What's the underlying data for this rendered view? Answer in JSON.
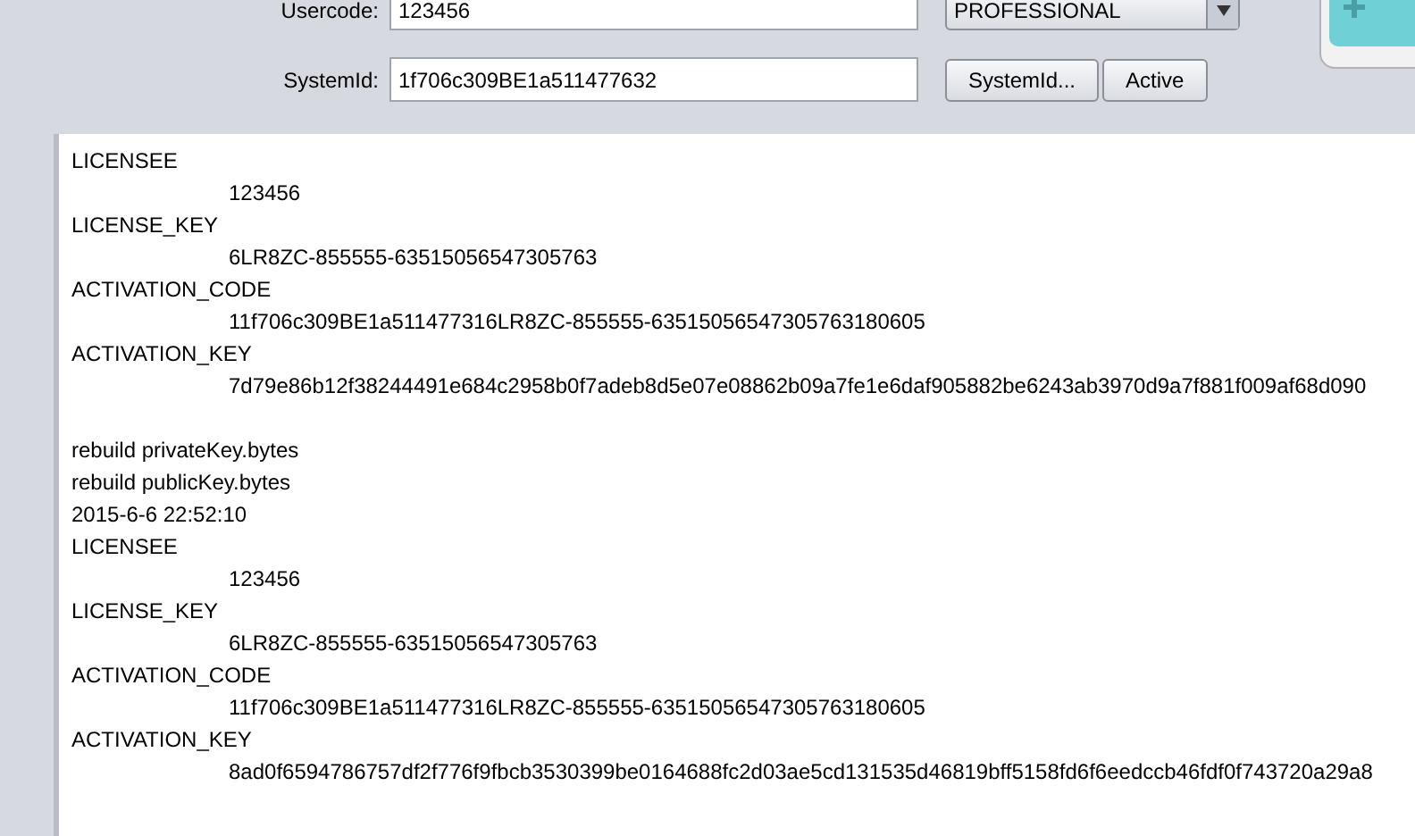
{
  "form": {
    "usercode": {
      "label": "Usercode:",
      "value": "123456"
    },
    "edition": {
      "value": "PROFESSIONAL"
    },
    "systemid": {
      "label": "SystemId:",
      "value": "1f706c309BE1a511477632"
    },
    "buttons": [
      "SystemId...",
      "Active"
    ]
  },
  "log": [
    {
      "kind": "label",
      "text": "LICENSEE"
    },
    {
      "kind": "value",
      "text": "123456"
    },
    {
      "kind": "label",
      "text": "LICENSE_KEY"
    },
    {
      "kind": "value",
      "text": "6LR8ZC-855555-63515056547305763"
    },
    {
      "kind": "label",
      "text": "ACTIVATION_CODE"
    },
    {
      "kind": "value",
      "text": "11f706c309BE1a511477316LR8ZC-855555-63515056547305763180605"
    },
    {
      "kind": "label",
      "text": "ACTIVATION_KEY"
    },
    {
      "kind": "value",
      "text": "7d79e86b12f38244491e684c2958b0f7adeb8d5e07e08862b09a7fe1e6daf905882be6243ab3970d9a7f881f009af68d090"
    },
    {
      "kind": "blank"
    },
    {
      "kind": "label",
      "text": "rebuild privateKey.bytes"
    },
    {
      "kind": "label",
      "text": "rebuild publicKey.bytes"
    },
    {
      "kind": "label",
      "text": "2015-6-6 22:52:10"
    },
    {
      "kind": "label",
      "text": "LICENSEE"
    },
    {
      "kind": "value",
      "text": "123456"
    },
    {
      "kind": "label",
      "text": "LICENSE_KEY"
    },
    {
      "kind": "value",
      "text": "6LR8ZC-855555-63515056547305763"
    },
    {
      "kind": "label",
      "text": "ACTIVATION_CODE"
    },
    {
      "kind": "value",
      "text": "11f706c309BE1a511477316LR8ZC-855555-63515056547305763180605"
    },
    {
      "kind": "label",
      "text": "ACTIVATION_KEY"
    },
    {
      "kind": "value",
      "text": "8ad0f6594786757df2f776f9fbcb3530399be0164688fc2d03ae5cd131535d46819bff5158fd6f6eedccb46fdf0f743720a29a8"
    }
  ]
}
